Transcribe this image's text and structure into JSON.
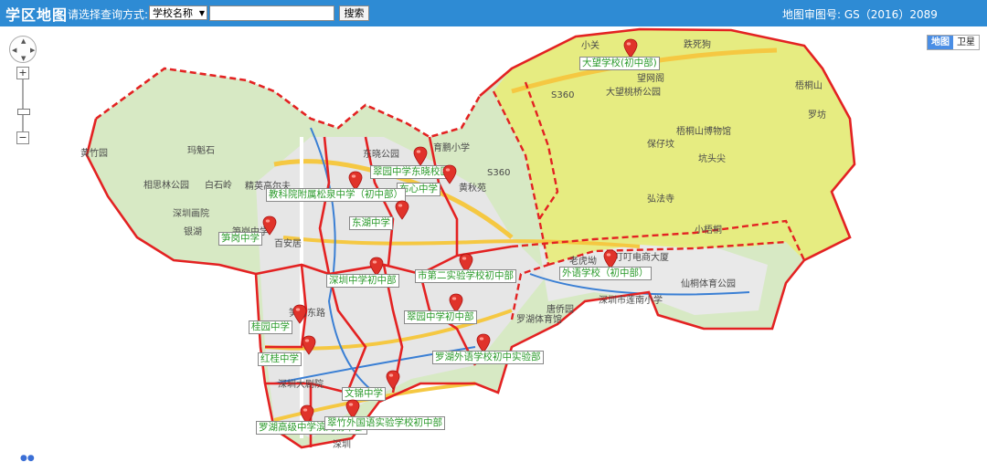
{
  "header": {
    "brand": "学区地图",
    "query_label": "请选择查询方式:",
    "select_value": "学校名称",
    "search_input_value": "",
    "search_button": "搜索",
    "approval_number": "地图审图号: GS（2016）2089"
  },
  "map_type": {
    "map": "地图",
    "satellite": "卫星"
  },
  "schools": [
    "大望学校(初中部)",
    "翠园中学东晓校区",
    "布心中学",
    "教科院附属松泉中学（初中部）",
    "东湖中学",
    "笋岗中学",
    "深圳中学初中部",
    "市第二实验学校初中部",
    "外语学校（初中部）",
    "翠园中学初中部",
    "桂园中学",
    "红桂中学",
    "罗湖外语学校初中实验部",
    "文锦中学",
    "罗湖高级中学滨河初中部",
    "翠竹外国语实验学校初中部"
  ],
  "place_labels": [
    "小关",
    "跌死狗",
    "望网阁",
    "大望桃桥公园",
    "S360",
    "梧桐山",
    "罗坊",
    "梧桐山博物馆",
    "保仔坟",
    "坑头尖",
    "弘法寺",
    "小梧桐",
    "黄竹园",
    "玛魁石",
    "相思林公园",
    "白石岭",
    "精英高尔夫",
    "深圳画院",
    "银湖",
    "笋岗中学",
    "百安居",
    "东晓公园",
    "育鹏小学",
    "黄秋苑",
    "S360",
    "叮叮电商大厦",
    "老虎坳",
    "仙桐体育公园",
    "深圳市莲南小学",
    "唐侨园",
    "罗湖体育馆",
    "笋岗东路",
    "深圳大剧院",
    "深圳"
  ],
  "colors": {
    "header_bar": "#2e8bd4",
    "district_border": "#e32222",
    "highlight_zone": "#e8ec7a",
    "school_label_text": "#2a9a2a",
    "marker": "#e0332a"
  }
}
